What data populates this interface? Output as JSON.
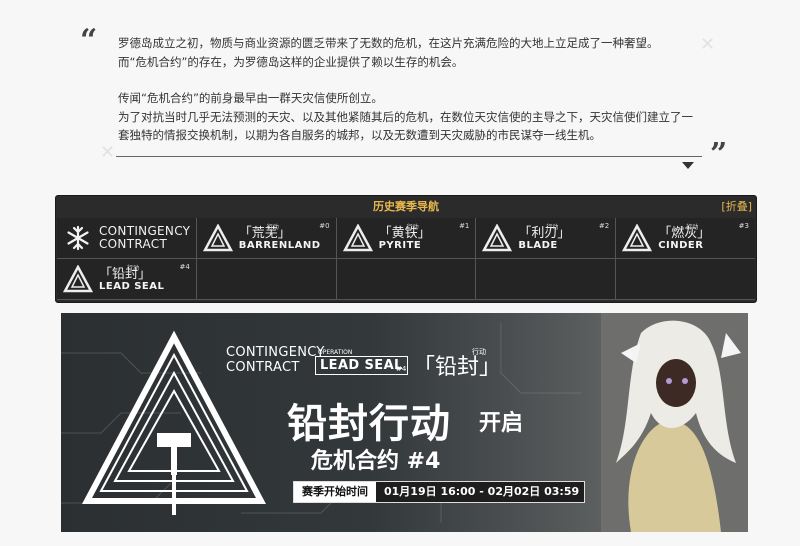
{
  "quote": {
    "open_mark": "“",
    "close_mark": "”",
    "paragraphs": [
      "罗德岛成立之初，物质与商业资源的匮乏带来了无数的危机，在这片充满危险的大地上立足成了一种奢望。",
      "而“危机合约”的存在，为罗德岛这样的企业提供了赖以生存的机会。",
      "传闻“危机合约”的前身最早由一群天灾信使所创立。",
      "为了对抗当时几乎无法预测的天灾、以及其他紧随其后的危机，在数位天灾信使的主导之下，天灾信使们建立了一套独特的情报交换机制，以期为各自服务的城邦，以及无数遭到天灾威胁的市民谋夺一线生机。"
    ]
  },
  "nav": {
    "title": "历史赛季导航",
    "toggle": "[折叠]",
    "logo_text_1": "CONTINGENCY",
    "logo_text_2": "CONTRACT",
    "operations": [
      {
        "cn": "「荒芜」",
        "tag": "行动",
        "num": "#0",
        "en": "BARRENLAND"
      },
      {
        "cn": "「黄铁」",
        "tag": "行动",
        "num": "#1",
        "en": "PYRITE"
      },
      {
        "cn": "「利刃」",
        "tag": "行动",
        "num": "#2",
        "en": "BLADE"
      },
      {
        "cn": "「燃灰」",
        "tag": "行动",
        "num": "#3",
        "en": "CINDER"
      },
      {
        "cn": "「铅封」",
        "tag": "行动",
        "num": "#4",
        "en": "LEAD SEAL"
      }
    ]
  },
  "banner": {
    "cc_1": "CONTINGENCY",
    "cc_2": "CONTRACT",
    "op_small": "OPERATION",
    "op_en": "LEAD SEAL",
    "op_num": "#4",
    "op_cn": "「铅封」",
    "op_tag": "行动",
    "title": "铅封行动",
    "title_suffix": "开启",
    "subtitle": "危机合约 #4",
    "time_label": "赛季开始时间",
    "time_value": "01月19日 16:00 - 02月02日 03:59"
  },
  "colors": {
    "nav_accent": "#e8b84d",
    "nav_bg": "#2b2b2b",
    "page_bg": "#f7f7f7"
  }
}
